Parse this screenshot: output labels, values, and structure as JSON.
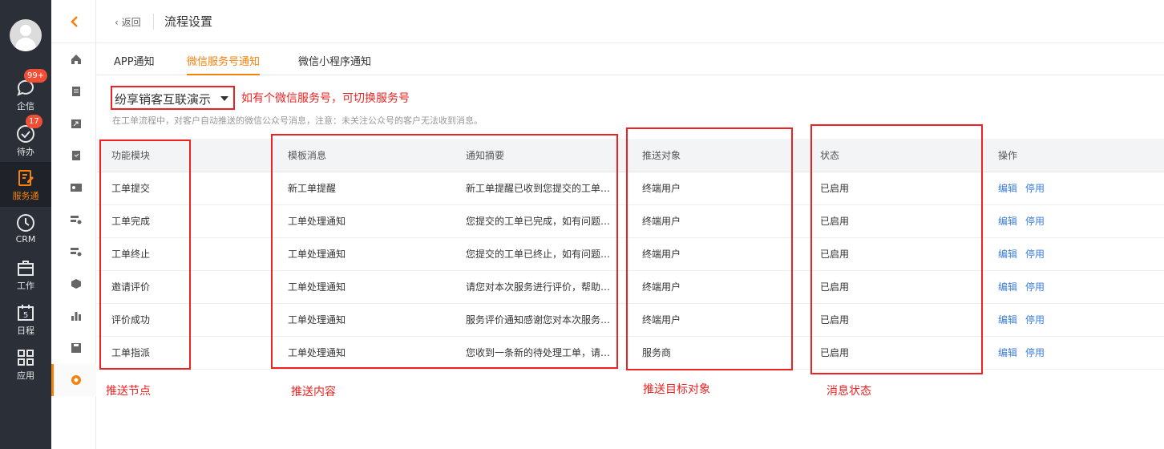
{
  "rail": {
    "items": [
      {
        "label": "企信",
        "badge": "99+"
      },
      {
        "label": "待办",
        "badge": "17"
      },
      {
        "label": "服务通",
        "badge": ""
      },
      {
        "label": "CRM",
        "badge": ""
      },
      {
        "label": "工作",
        "badge": ""
      },
      {
        "label": "日程",
        "badge": "",
        "icon_text": "5"
      },
      {
        "label": "应用",
        "badge": ""
      }
    ],
    "active_color": "#f6820d"
  },
  "header": {
    "back_label": "返回",
    "title": "流程设置"
  },
  "tabs": [
    {
      "label": "APP通知"
    },
    {
      "label": "微信服务号通知"
    },
    {
      "label": "微信小程序通知"
    }
  ],
  "account_select": {
    "value": "纷享销客互联演示"
  },
  "annotations": {
    "account": "如有个微信服务号，可切换服务号",
    "node": "推送节点",
    "content": "推送内容",
    "target": "推送目标对象",
    "status": "消息状态"
  },
  "description": "在工单流程中，对客户自动推送的微信公众号消息，注意：未关注公众号的客户无法收到消息。",
  "table": {
    "columns": [
      "功能模块",
      "模板消息",
      "通知摘要",
      "推送对象",
      "状态",
      "操作"
    ],
    "rows": [
      {
        "module": "工单提交",
        "template": "新工单提醒",
        "summary": "新工单提醒已收到您提交的工单…",
        "target": "终端用户",
        "status": "已启用"
      },
      {
        "module": "工单完成",
        "template": "工单处理通知",
        "summary": "您提交的工单已完成，如有问题…",
        "target": "终端用户",
        "status": "已启用"
      },
      {
        "module": "工单终止",
        "template": "工单处理通知",
        "summary": "您提交的工单已终止，如有问题…",
        "target": "终端用户",
        "status": "已启用"
      },
      {
        "module": "邀请评价",
        "template": "工单处理通知",
        "summary": "请您对本次服务进行评价，帮助…",
        "target": "终端用户",
        "status": "已启用"
      },
      {
        "module": "评价成功",
        "template": "工单处理通知",
        "summary": "服务评价通知感谢您对本次服务…",
        "target": "终端用户",
        "status": "已启用"
      },
      {
        "module": "工单指派",
        "template": "工单处理通知",
        "summary": "您收到一条新的待处理工单，请…",
        "target": "服务商",
        "status": "已启用"
      }
    ],
    "actions": {
      "edit": "编辑",
      "disable": "停用"
    }
  }
}
